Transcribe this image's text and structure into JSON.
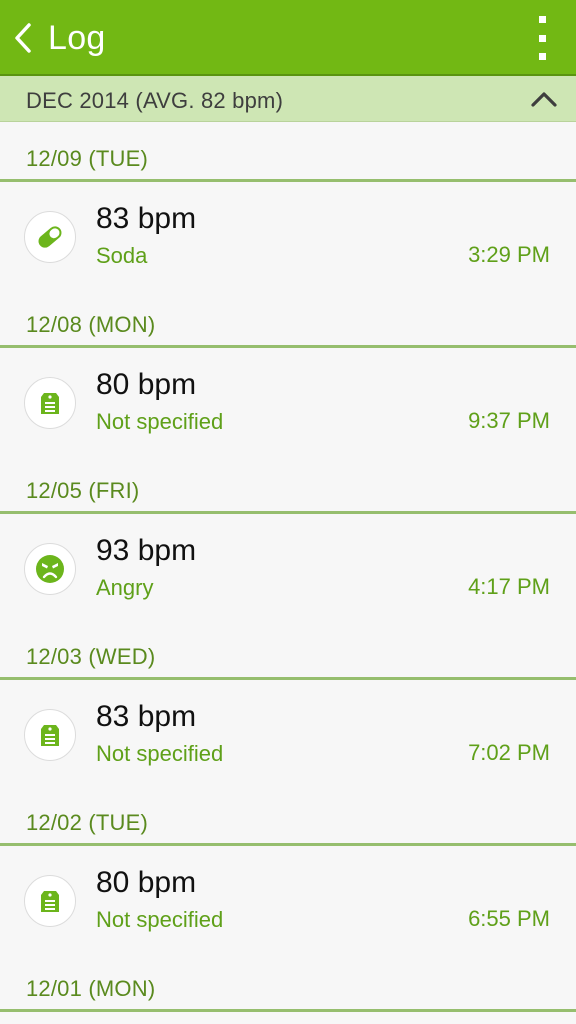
{
  "header": {
    "title": "Log",
    "accent_color": "#72b814"
  },
  "month": {
    "label": "DEC 2014 (AVG. 82 bpm)",
    "background": "#cee6b4"
  },
  "days": [
    {
      "date": "12/09 (TUE)",
      "entries": [
        {
          "bpm": "83 bpm",
          "tag": "Soda",
          "time": "3:29 PM",
          "icon": "pill-icon"
        }
      ]
    },
    {
      "date": "12/08 (MON)",
      "entries": [
        {
          "bpm": "80 bpm",
          "tag": "Not specified",
          "time": "9:37 PM",
          "icon": "tag-icon"
        }
      ]
    },
    {
      "date": "12/05 (FRI)",
      "entries": [
        {
          "bpm": "93 bpm",
          "tag": "Angry",
          "time": "4:17 PM",
          "icon": "angry-face-icon"
        }
      ]
    },
    {
      "date": "12/03 (WED)",
      "entries": [
        {
          "bpm": "83 bpm",
          "tag": "Not specified",
          "time": "7:02 PM",
          "icon": "tag-icon"
        }
      ]
    },
    {
      "date": "12/02 (TUE)",
      "entries": [
        {
          "bpm": "80 bpm",
          "tag": "Not specified",
          "time": "6:55 PM",
          "icon": "tag-icon"
        }
      ]
    },
    {
      "date": "12/01 (MON)",
      "entries": []
    }
  ]
}
